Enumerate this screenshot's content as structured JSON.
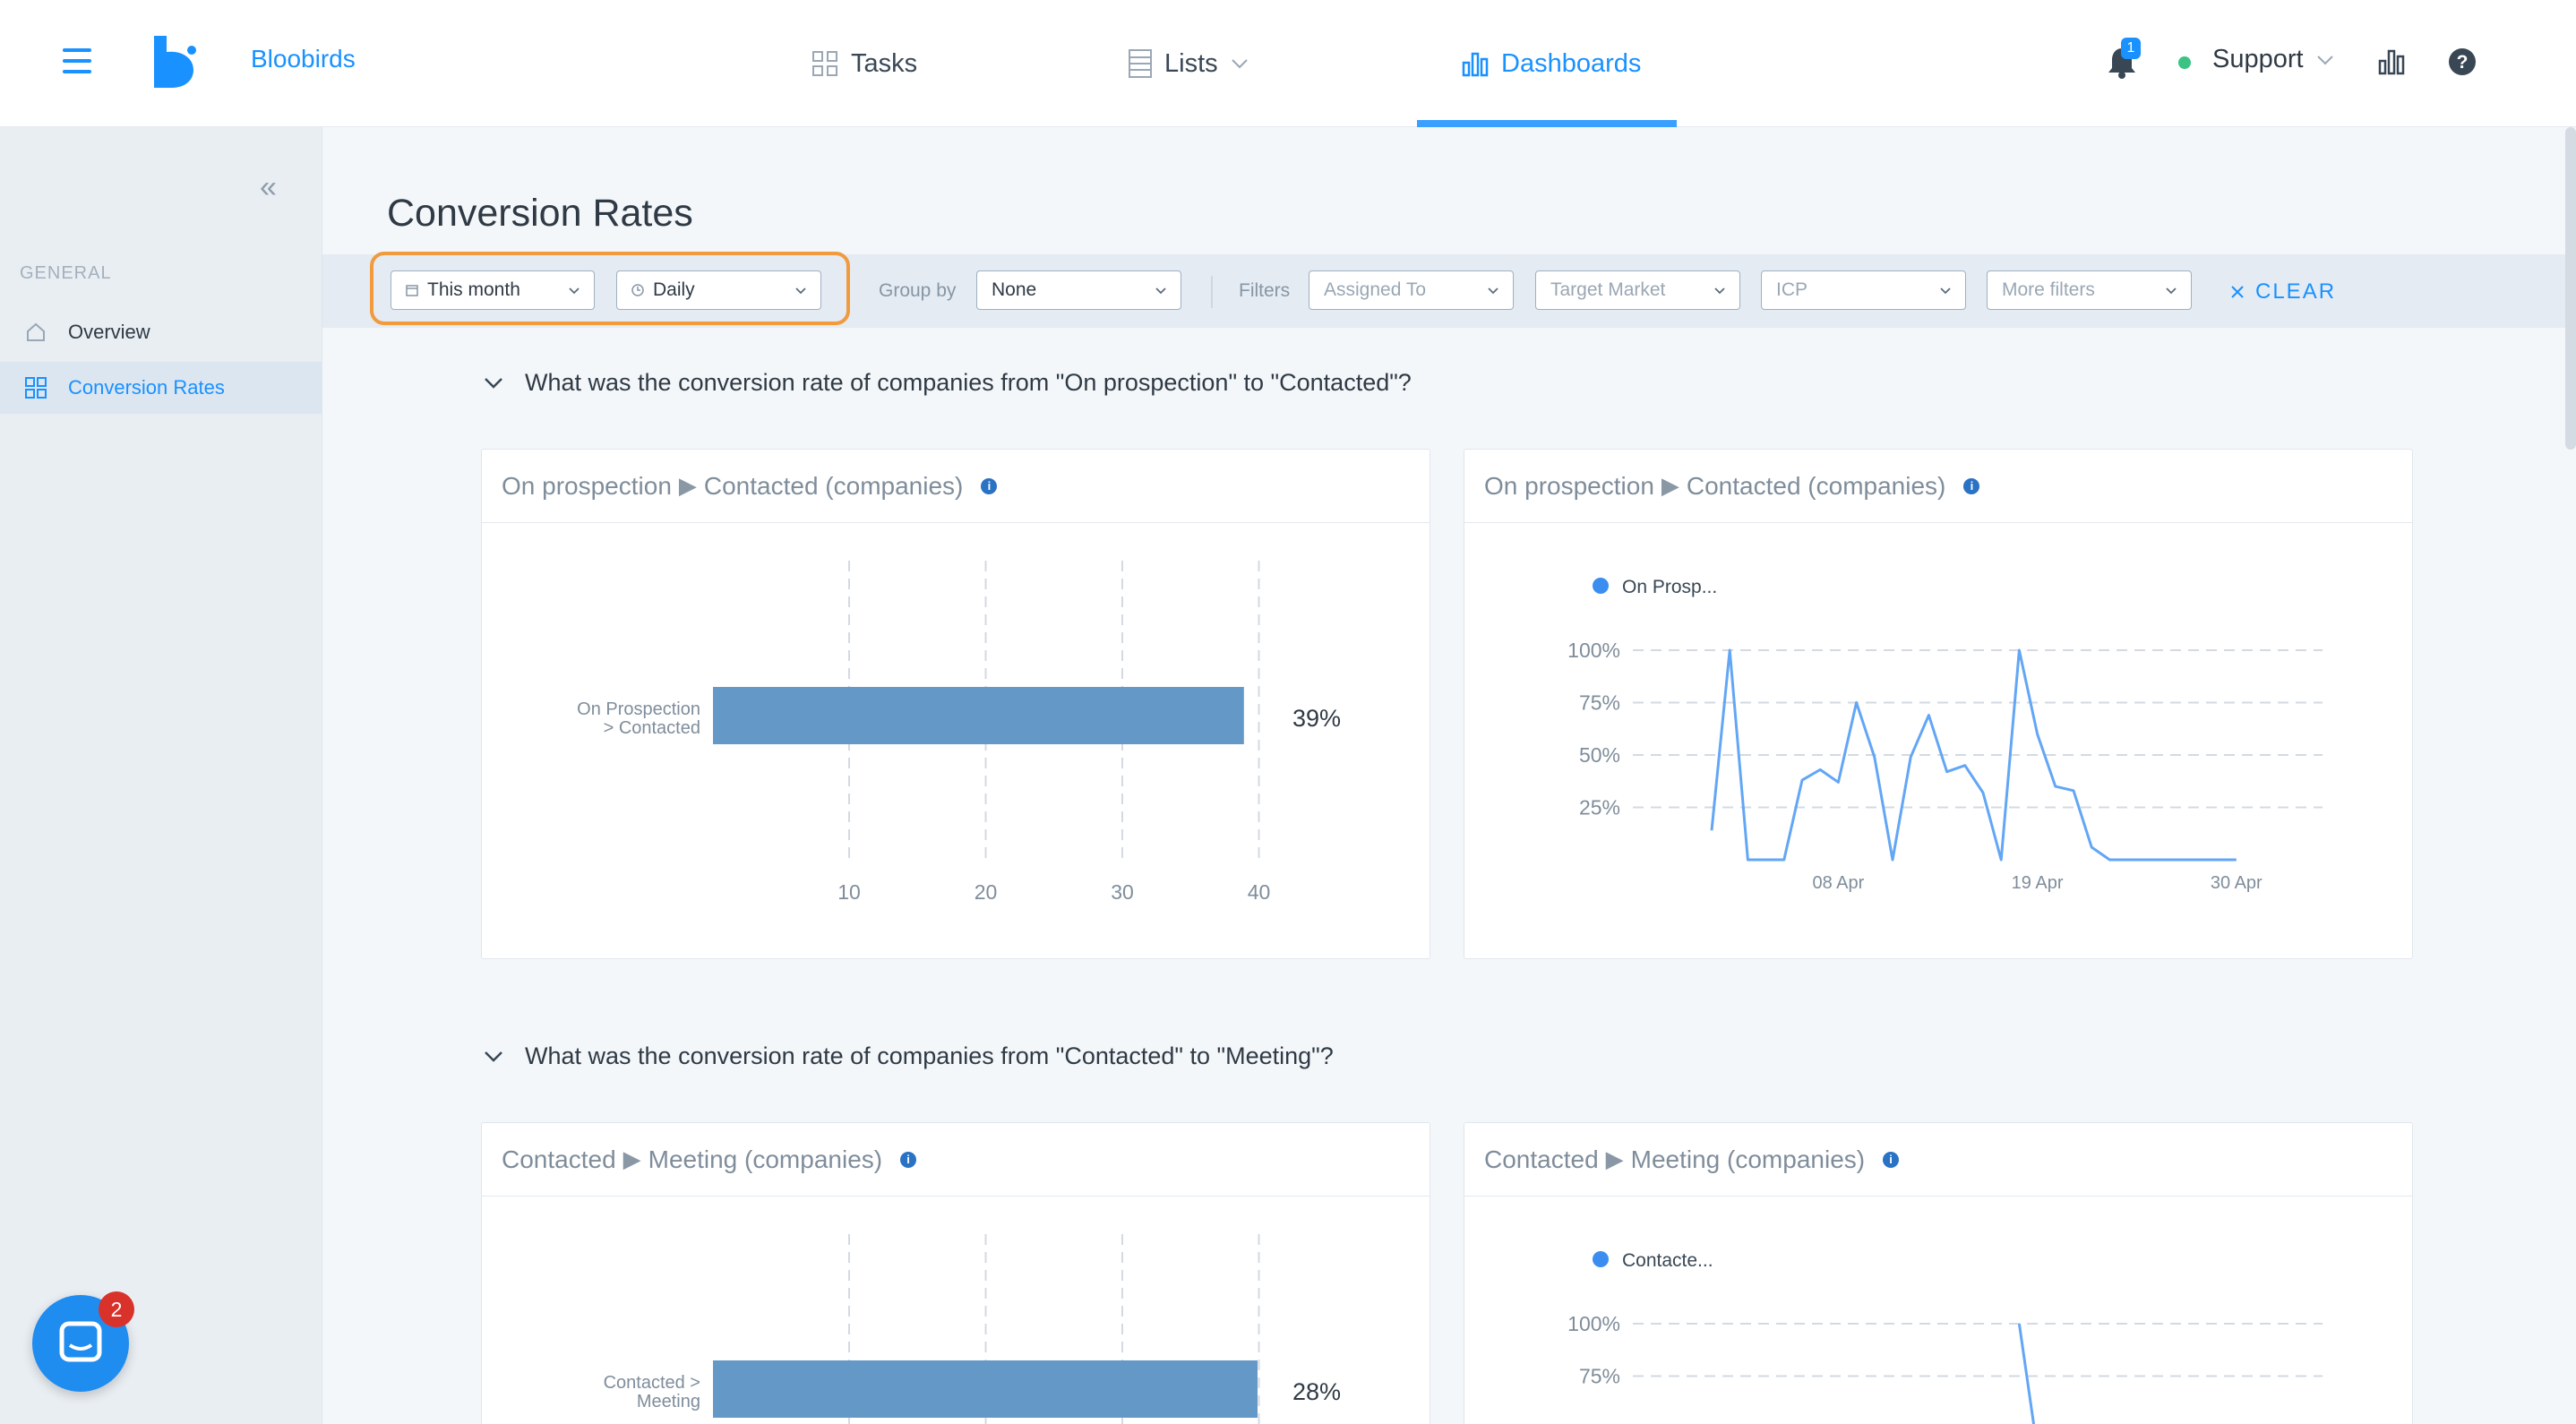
{
  "header": {
    "brand": "Bloobirds",
    "nav": [
      {
        "label": "Tasks",
        "icon": "grid-icon"
      },
      {
        "label": "Lists",
        "icon": "list-icon"
      },
      {
        "label": "Dashboards",
        "icon": "bar-chart-icon",
        "active": true
      }
    ],
    "notifications_count": "1",
    "user_label": "Support",
    "status_color": "#3cc283",
    "accent_color": "#1991ff"
  },
  "sidebar": {
    "section": "GENERAL",
    "items": [
      {
        "label": "Overview",
        "icon": "home-icon"
      },
      {
        "label": "Conversion Rates",
        "icon": "dashboard-grid-icon",
        "active": true
      }
    ]
  },
  "page": {
    "title": "Conversion Rates"
  },
  "filters": {
    "date_range": "This month",
    "granularity": "Daily",
    "group_by_label": "Group by",
    "group_by_value": "None",
    "filters_label": "Filters",
    "assigned_to": "Assigned To",
    "target_market": "Target Market",
    "icp": "ICP",
    "more_filters": "More filters",
    "clear": "CLEAR"
  },
  "sections": [
    {
      "question": "What was the conversion rate of companies from \"On prospection\" to \"Contacted\"?",
      "from": "On prospection",
      "to": "Contacted (companies)"
    },
    {
      "question": "What was the conversion rate of companies from \"Contacted\" to \"Meeting\"?",
      "from": "Contacted",
      "to": "Meeting (companies)"
    }
  ],
  "chart_data": [
    {
      "type": "bar",
      "orientation": "horizontal",
      "categories": [
        "On Prospection > Contacted"
      ],
      "category_lines": [
        "On Prospection",
        "> Contacted"
      ],
      "values": [
        39
      ],
      "value_labels": [
        "39%"
      ],
      "xlim": [
        0,
        40
      ],
      "xticks": [
        10,
        20,
        30,
        40
      ],
      "color": "#6499c7",
      "grid": "vertical dashed"
    },
    {
      "type": "line",
      "legend": [
        "On Prosp..."
      ],
      "legend_position": "top-left",
      "x": [
        "Apr 1",
        "Apr 2",
        "Apr 3",
        "Apr 4",
        "Apr 5",
        "Apr 6",
        "Apr 7",
        "Apr 8",
        "Apr 9",
        "Apr 10",
        "Apr 11",
        "Apr 12",
        "Apr 13",
        "Apr 14",
        "Apr 15",
        "Apr 16",
        "Apr 17",
        "Apr 18",
        "Apr 19",
        "Apr 20",
        "Apr 21",
        "Apr 22",
        "Apr 23",
        "Apr 24",
        "Apr 25",
        "Apr 26",
        "Apr 27",
        "Apr 28",
        "Apr 29",
        "Apr 30"
      ],
      "xticks": [
        "08 Apr",
        "19 Apr",
        "30 Apr"
      ],
      "yticks": [
        "100%",
        "75%",
        "50%",
        "25%"
      ],
      "ylim": [
        0,
        100
      ],
      "values": [
        14,
        100,
        0,
        0,
        0,
        38,
        43,
        37,
        75,
        49,
        0,
        49,
        69,
        42,
        45,
        32,
        0,
        100,
        60,
        35,
        33,
        6,
        0,
        0,
        0,
        0,
        0,
        0,
        0,
        0
      ],
      "color": "#62a6f5",
      "grid": "horizontal dashed"
    },
    {
      "type": "bar",
      "orientation": "horizontal",
      "categories": [
        "Contacted > Meeting"
      ],
      "category_lines": [
        "Contacted >",
        "Meeting"
      ],
      "values": [
        40
      ],
      "value_labels": [
        "28%"
      ],
      "xlim": [
        0,
        40
      ],
      "xticks": [
        10,
        20,
        30,
        40
      ],
      "color": "#6499c7",
      "grid": "vertical dashed"
    },
    {
      "type": "line",
      "legend": [
        "Contacte..."
      ],
      "legend_position": "top-left",
      "yticks": [
        "100%",
        "75%"
      ],
      "ylim": [
        0,
        100
      ],
      "values": [
        null,
        null,
        null,
        null,
        null,
        null,
        null,
        null,
        null,
        null,
        null,
        null,
        null,
        null,
        null,
        null,
        null,
        100,
        40,
        45
      ],
      "color": "#62a6f5",
      "grid": "horizontal dashed"
    }
  ],
  "chat": {
    "badge": "2"
  }
}
